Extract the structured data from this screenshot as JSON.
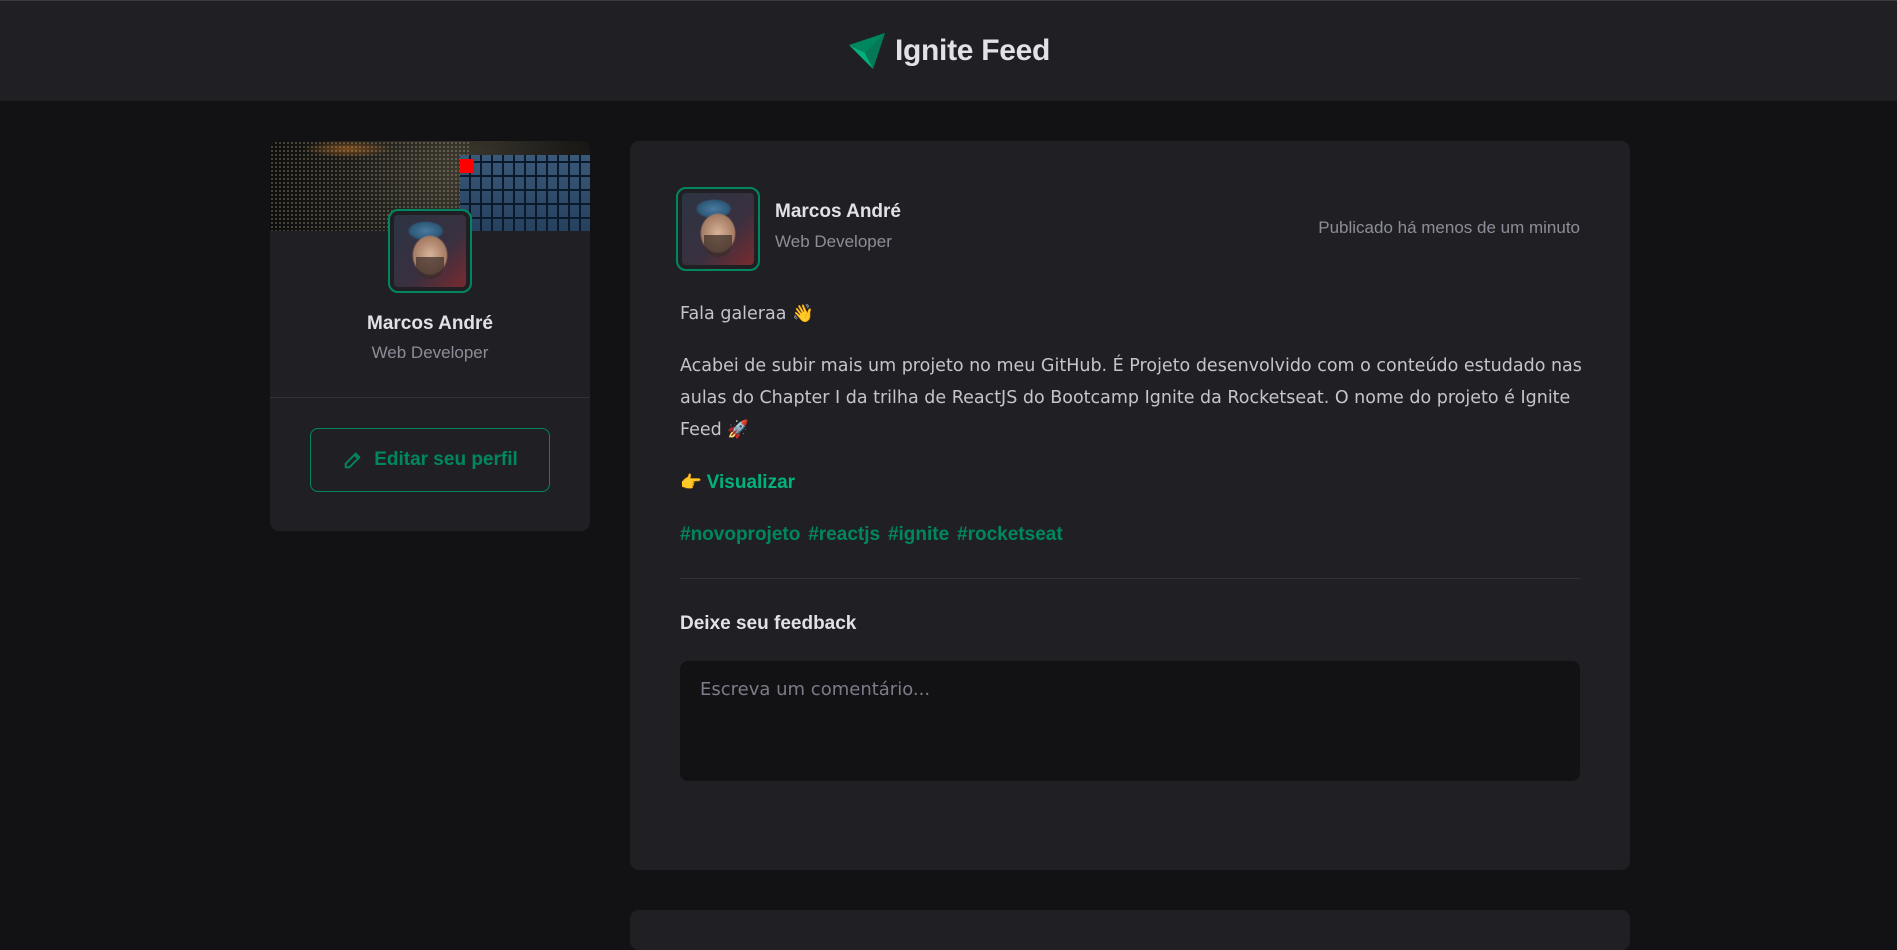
{
  "header": {
    "title": "Ignite Feed",
    "logo_icon": "ignite-logo-icon"
  },
  "sidebar": {
    "name": "Marcos André",
    "role": "Web Developer",
    "edit_button": "Editar seu perfil"
  },
  "post": {
    "author": {
      "name": "Marcos André",
      "role": "Web Developer"
    },
    "published": "Publicado há menos de um minuto",
    "greeting": "Fala galeraa 👋",
    "body": "Acabei de subir mais um projeto no meu GitHub. É Projeto desenvolvido com o conteúdo estudado nas aulas do Chapter I da trilha de ReactJS do Bootcamp Ignite da Rocketseat. O nome do projeto é Ignite Feed 🚀",
    "link_prefix": "👉",
    "link_label": "Visualizar",
    "hashtags": [
      "#novoprojeto",
      "#reactjs",
      "#ignite",
      "#rocketseat"
    ],
    "feedback_title": "Deixe seu feedback",
    "comment_placeholder": "Escreva um comentário..."
  },
  "colors": {
    "brand": "#00875f",
    "brand_light": "#00b37e",
    "bg": "#121214",
    "card": "#202024"
  }
}
